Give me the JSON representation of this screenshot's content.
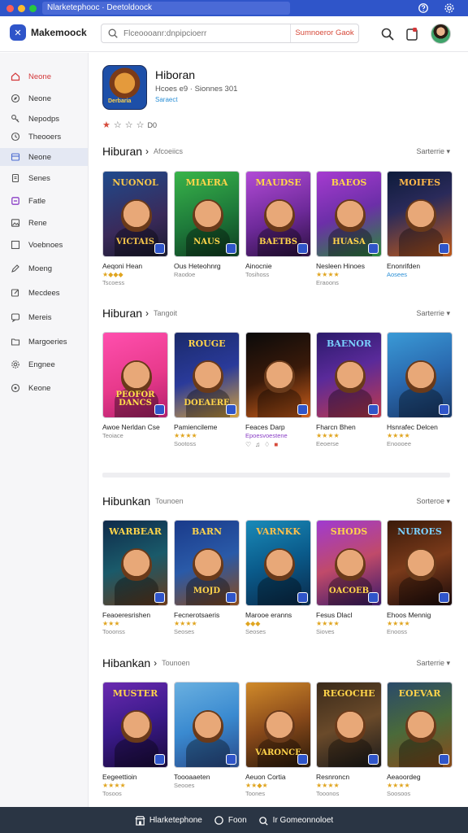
{
  "window": {
    "url": "Nlarketephooc · Deetoldoock"
  },
  "header": {
    "brand": "Makemoock",
    "search_placeholder": "Flceoooanr:dnpipcioerr",
    "search_filter": "Sumnoeror Gaok",
    "brand_color": "#2f55c9",
    "accent_color": "#d3383a"
  },
  "sidebar": {
    "items": [
      {
        "label": "Neone",
        "icon": "home-icon"
      },
      {
        "label": "Neone",
        "icon": "compass-icon"
      },
      {
        "label": "Nepodps",
        "icon": "key-icon"
      },
      {
        "label": "Theooers",
        "icon": "clock-icon"
      },
      {
        "label": "Neone",
        "icon": "grid-icon"
      },
      {
        "label": "Senes",
        "icon": "doc-icon"
      },
      {
        "label": "Fatle",
        "icon": "square-icon"
      },
      {
        "label": "Rene",
        "icon": "image-icon"
      },
      {
        "label": "Voebnoes",
        "icon": "box-icon"
      },
      {
        "label": "Moeng",
        "icon": "pen-icon"
      },
      {
        "label": "Mecdees",
        "icon": "edit-icon"
      },
      {
        "label": "Mereis",
        "icon": "chat-icon"
      },
      {
        "label": "Margoeries",
        "icon": "folder-icon"
      },
      {
        "label": "Engnee",
        "icon": "gear-icon"
      },
      {
        "label": "Keone",
        "icon": "settings-icon"
      }
    ]
  },
  "hero": {
    "title": "Hiboran",
    "cover_tag": "Derbaria",
    "meta": "Hcoes e9 ·  Sionnes 301",
    "link": "Saraect",
    "rating_text": "D0"
  },
  "sections": [
    {
      "title": "Hiburan",
      "chevron": "›",
      "subtitle": "Afcoeiics",
      "sort": "Sarterrie ▾",
      "cards": [
        {
          "cover": [
            "NUONOL",
            "VICTAIS"
          ],
          "title": "Aeqoni Hean",
          "stars": "★◆◆◆",
          "sub": "Tscoess",
          "sub_style": "",
          "bg": "linear-gradient(160deg,#1f4a8c,#3a2a5a 60%,#1a1a2e)",
          "fg": "#f5c54a"
        },
        {
          "cover": [
            "MIAERA",
            "NAUS"
          ],
          "title": "Ous Heteohnrg",
          "stars": "",
          "sub": "Raodoe",
          "sub_style": "",
          "bg": "linear-gradient(160deg,#39b44a,#1e7a3a 55%,#0f3d20)",
          "fg": "#ffd44a"
        },
        {
          "cover": [
            "MAUDSE",
            "BAETBS"
          ],
          "title": "Ainocnie",
          "stars": "",
          "sub": "Tosihoss",
          "sub_style": "",
          "bg": "linear-gradient(160deg,#b24bd6,#6e2a9a 55%,#2c1040)",
          "fg": "#ffd44a"
        },
        {
          "cover": [
            "BAEOS",
            "HUASA"
          ],
          "title": "Nesleen Hinoes",
          "stars": "★★★★",
          "sub": "Eraoons",
          "sub_style": "",
          "bg": "linear-gradient(160deg,#a63bd0,#6c2fa8 50%,#2a8a3a)",
          "fg": "#ffd44a"
        },
        {
          "cover": [
            "MOIFES",
            ""
          ],
          "title": "Enonrifden",
          "stars": "",
          "sub": "Aosees",
          "sub_style": "blue",
          "bg": "linear-gradient(160deg,#0d1b3a,#2a2a5a 40%,#c05a1a)",
          "fg": "#ffb84a"
        }
      ]
    },
    {
      "title": "Hiburan",
      "chevron": "›",
      "subtitle": "Tangoit",
      "sort": "Sarterrie ▾",
      "cards": [
        {
          "cover": [
            "",
            "PEOFOR DANCS"
          ],
          "title": "Awoe Nerldan Cse",
          "stars": "",
          "sub": "Teoiace",
          "sub_style": "",
          "bg": "linear-gradient(160deg,#ff4fae,#e83a8c 55%,#b21f6a)",
          "fg": "#ffe04a"
        },
        {
          "cover": [
            "ROUGE",
            "DOEAERE"
          ],
          "title": "Pamiencileme",
          "stars": "★★★★",
          "sub": "Sootoss",
          "sub_style": "",
          "bg": "linear-gradient(160deg,#1a2a6a,#2a3a9a 50%,#d6a23a)",
          "fg": "#ffd44a"
        },
        {
          "cover": [
            "",
            ""
          ],
          "title": "Feaces Darp",
          "stars": "",
          "sub": "Epoesvoestene",
          "sub_style": "purple",
          "bg": "linear-gradient(160deg,#0a0a0a,#3a1a0a 50%,#d0601a)",
          "fg": "#ffb84a"
        },
        {
          "cover": [
            "BAENOR",
            ""
          ],
          "title": "Fharcn Bhen",
          "stars": "★★★★",
          "sub": "Eeoerse",
          "sub_style": "",
          "bg": "linear-gradient(160deg,#2a1a6a,#5a2a9a 45%,#c03a4a)",
          "fg": "#7ad0ff"
        },
        {
          "cover": [
            "",
            ""
          ],
          "title": "Hsnrafec Delcen",
          "stars": "★★★★",
          "sub": "Enoooee",
          "sub_style": "",
          "bg": "linear-gradient(160deg,#3a9ad6,#2a6ab0 50%,#1a3a6a)",
          "fg": "#ffd44a"
        }
      ],
      "extra": [
        "♡",
        "♫",
        "♢",
        "■"
      ]
    },
    {
      "title": "Hibunkan",
      "chevron": "",
      "subtitle": "Tounoen",
      "sort": "Sorteroe ▾",
      "cards": [
        {
          "cover": [
            "WARBEAR",
            ""
          ],
          "title": "Feaoeresrishen",
          "stars": "★★★",
          "sub": "Tooonss",
          "sub_style": "",
          "bg": "linear-gradient(160deg,#0f2a4a,#1a5a6a 50%,#6a3a1a)",
          "fg": "#ffd44a"
        },
        {
          "cover": [
            "BARN",
            "MOJD"
          ],
          "title": "Fecnerotsaeris",
          "stars": "★★★★",
          "sub": "Seoses",
          "sub_style": "",
          "bg": "linear-gradient(160deg,#1a3a8a,#2a5aa8 50%,#8a4a1a)",
          "fg": "#ffd44a"
        },
        {
          "cover": [
            "VARNKK",
            ""
          ],
          "title": "Marooe eranns",
          "stars": "◆◆◆",
          "sub": "Seoses",
          "sub_style": "",
          "bg": "linear-gradient(160deg,#1a8ab8,#0a5a8a 50%,#0a2a4a)",
          "fg": "#ffc04a"
        },
        {
          "cover": [
            "SHODS",
            "OACOEB"
          ],
          "title": "Fesus Dlacl",
          "stars": "★★★★",
          "sub": "Sioves",
          "sub_style": "",
          "bg": "linear-gradient(160deg,#a03ad0,#c04a6a 50%,#3a1a6a)",
          "fg": "#ffd44a"
        },
        {
          "cover": [
            "NUROES",
            ""
          ],
          "title": "Ehoos Mennig",
          "stars": "★★★★",
          "sub": "Enooss",
          "sub_style": "",
          "bg": "linear-gradient(160deg,#3a1a0a,#7a3a1a 50%,#1a0a0a)",
          "fg": "#7ad0ff"
        }
      ]
    },
    {
      "title": "Hibankan",
      "chevron": "›",
      "subtitle": "Tounoen",
      "sort": "Sarterrie ▾",
      "cards": [
        {
          "cover": [
            "MUSTER",
            ""
          ],
          "title": "Eegeettioin",
          "stars": "★★★★",
          "sub": "Tosoos",
          "sub_style": "",
          "bg": "linear-gradient(160deg,#6a2ab0,#3a1a8a 50%,#1a0a3a)",
          "fg": "#ffd44a"
        },
        {
          "cover": [
            "",
            ""
          ],
          "title": "Toooaaeten",
          "stars": "",
          "sub": "Seooes",
          "sub_style": "",
          "bg": "linear-gradient(160deg,#6ab0e0,#3a8ad0 50%,#2a4a8a)",
          "fg": "#ffd44a"
        },
        {
          "cover": [
            "",
            "VARONCE"
          ],
          "title": "Aeuon Cortia",
          "stars": "★★◆★",
          "sub": "Toones",
          "sub_style": "",
          "bg": "linear-gradient(160deg,#d08a2a,#8a4a1a 50%,#2a1a0a)",
          "fg": "#ffd44a"
        },
        {
          "cover": [
            "REGOCHE",
            ""
          ],
          "title": "Resnroncn",
          "stars": "★★★★",
          "sub": "Tooonos",
          "sub_style": "",
          "bg": "linear-gradient(160deg,#3a2a1a,#6a4a2a 50%,#1a1a1a)",
          "fg": "#ffd44a"
        },
        {
          "cover": [
            "EOEVAR",
            ""
          ],
          "title": "Aeaoordeg",
          "stars": "★★★★",
          "sub": "Soosoos",
          "sub_style": "",
          "bg": "linear-gradient(160deg,#2a4a6a,#4a6a3a 50%,#8a4a1a)",
          "fg": "#ffd44a"
        }
      ]
    }
  ],
  "footer": {
    "items": [
      {
        "label": "Hlarketephone",
        "icon": "store-icon"
      },
      {
        "label": "Foon",
        "icon": "circle-icon"
      },
      {
        "label": "Ir Gomeonnoloet",
        "icon": "link-icon"
      }
    ]
  }
}
